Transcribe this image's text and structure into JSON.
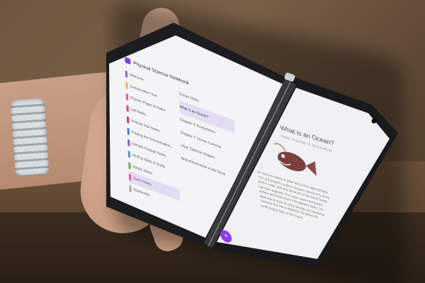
{
  "left_screen": {
    "app_title": "Physical Science Notebook",
    "section_items": [
      "Welcome",
      "Conservation Sort",
      "Physics Paper & Notes",
      "Lab Notes",
      "Velocity Test Notes",
      "Finding the Concentration...",
      "Climate Change Notes",
      "Writing Ideas & Drafts",
      "Adobe Notes",
      "Class Notes",
      "Notebooks"
    ],
    "page_items": [
      "Ocean Notes",
      "What is an Ocean?",
      "Chapter 3: Ecosystems",
      "Chapter 7: Ocean Currents",
      "Hear Typhoon Shapes",
      "Bioluminescence in the Deep"
    ],
    "add_label": "+"
  },
  "right_screen": {
    "page_title": "What is an Ocean?",
    "date_line": "Friday, November 15, 2019   9:48 AM",
    "body_lines": [
      "An ocean is a body of water that covers approximately",
      "71% of the Earth's surface. Oceans contain 97% of the",
      "Earth's water, and only about 5% of the World Ocean",
      "has been explored. The ocean covers the Earth's",
      "surface and holds most of the planet's water. The",
      "deep sea is home to many strange and wonderful",
      "creatures that live in darkness, far below the",
      "sunlit surface layer of the ocean."
    ]
  },
  "colors": {
    "accent": "#7b3fe4",
    "fab": "#8c3be6",
    "selected": "#e3ddf3"
  }
}
